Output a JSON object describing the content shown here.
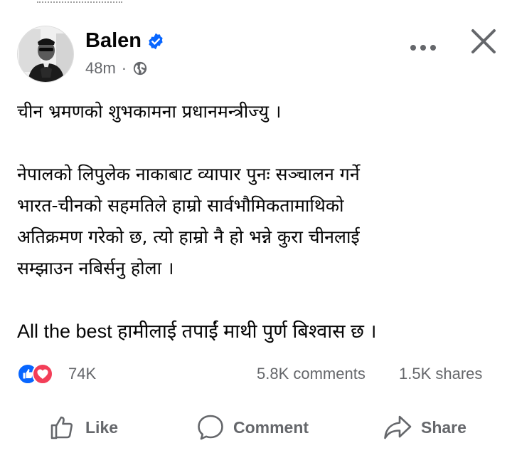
{
  "post": {
    "author": "Balen",
    "time": "48m",
    "separator": "·",
    "paragraphs": [
      [
        "चीन भ्रमणको शुभकामना प्रधानमन्त्रीज्यु ।"
      ],
      [
        "नेपालको लिपुलेक नाकाबाट व्यापार पुनः सञ्चालन गर्ने",
        "भारत-चीनको सहमतिले हाम्रो सार्वभौमिकतामाथिको",
        "अतिक्रमण गरेको छ, त्यो हाम्रो नै हो भन्ने कुरा चीनलाई",
        "सम्झाउन नबिर्सनु होला ।"
      ],
      [
        "All the best हामीलाई तपाईं माथी पुर्ण बिश्वास छ ।"
      ]
    ]
  },
  "engagement": {
    "reactions": "74K",
    "comments": "5.8K comments",
    "shares": "1.5K shares"
  },
  "actions": {
    "like": "Like",
    "comment": "Comment",
    "share": "Share"
  },
  "colors": {
    "brand_blue": "#0866ff",
    "love_red": "#f33e58",
    "muted_text": "#65676b"
  },
  "icons": [
    "verified-badge-icon",
    "globe-icon",
    "more-options-icon",
    "close-icon",
    "like-reaction-icon",
    "love-reaction-icon",
    "thumbs-up-icon",
    "comment-bubble-icon",
    "share-arrow-icon"
  ]
}
